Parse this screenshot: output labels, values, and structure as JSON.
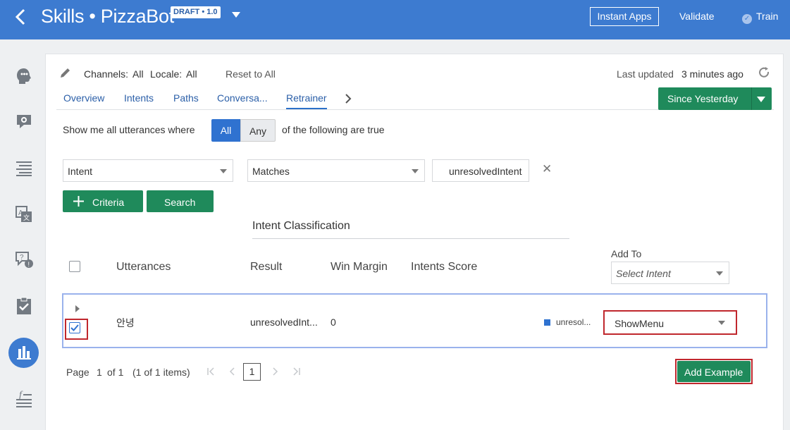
{
  "header": {
    "title": "Skills • PizzaBot",
    "badge": "DRAFT • 1.0",
    "instant_apps": "Instant Apps",
    "validate": "Validate",
    "train": "Train"
  },
  "sidebar": {
    "items": [
      {
        "icon": "bot-head-icon"
      },
      {
        "icon": "gear-bubble-icon"
      },
      {
        "icon": "lines-icon"
      },
      {
        "icon": "translate-icon"
      },
      {
        "icon": "question-bubble-icon"
      },
      {
        "icon": "clipboard-check-icon"
      },
      {
        "icon": "bar-chart-icon",
        "active": true
      },
      {
        "icon": "function-icon"
      }
    ]
  },
  "toolbar": {
    "channels_label": "Channels:",
    "channels_value": "All",
    "locale_label": "Locale:",
    "locale_value": "All",
    "reset": "Reset to All",
    "last_updated_label": "Last updated",
    "last_updated_value": "3 minutes ago"
  },
  "tabs": [
    "Overview",
    "Intents",
    "Paths",
    "Conversa...",
    "Retrainer"
  ],
  "since": "Since Yesterday",
  "filter": {
    "prefix": "Show me all utterances where",
    "all": "All",
    "any": "Any",
    "suffix": "of the following are true",
    "field": "Intent",
    "operator": "Matches",
    "value": "unresolvedIntent",
    "criteria_button": "Criteria",
    "search_button": "Search"
  },
  "table": {
    "group_header": "Intent Classification",
    "columns": [
      "Utterances",
      "Result",
      "Win Margin",
      "Intents Score"
    ],
    "add_to_label": "Add To",
    "select_intent_placeholder": "Select Intent",
    "rows": [
      {
        "utterance": "안녕",
        "result": "unresolvedInt...",
        "win_margin": "0",
        "intent_score": "unresol...",
        "add_to": "ShowMenu",
        "checked": true
      }
    ]
  },
  "pager": {
    "page_label": "Page",
    "page": "1",
    "of": "of 1",
    "items": "(1 of 1 items)",
    "current": "1"
  },
  "add_example": "Add Example",
  "colors": {
    "header_blue": "#3d7bd0",
    "green": "#1f8a5b",
    "highlight_red": "#c0272d"
  }
}
